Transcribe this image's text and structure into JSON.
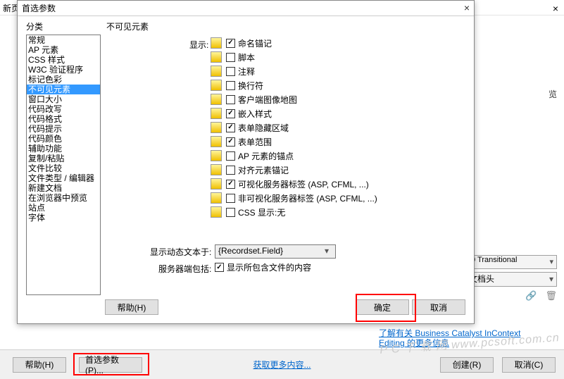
{
  "bg_window": {
    "title": "新页",
    "close_icon": "×",
    "right_label": "览",
    "select1": ".0 Transitional",
    "select2": "文档头",
    "icon_link": "🔗",
    "icon_trash": "🗑",
    "ing": "ing",
    "link_line1": "了解有关 Business Catalyst InContext",
    "link_line2": "Editing 的更多信息"
  },
  "bottom": {
    "help": "帮助(H)",
    "pref": "首选参数(P)...",
    "more_link": "获取更多内容...",
    "create": "创建(R)",
    "cancel": "取消(C)"
  },
  "dialog": {
    "title": "首选参数",
    "close_icon": "×",
    "cat_label": "分类",
    "page_title": "不可见元素",
    "categories": [
      "常规",
      "AP 元素",
      "CSS 样式",
      "W3C 验证程序",
      "标记色彩",
      "不可见元素",
      "窗口大小",
      "代码改写",
      "代码格式",
      "代码提示",
      "代码颜色",
      "辅助功能",
      "复制/粘贴",
      "文件比较",
      "文件类型 / 编辑器",
      "新建文档",
      "在浏览器中预览",
      "站点",
      "字体"
    ],
    "selected_index": 5,
    "show_label": "显示:",
    "options": [
      {
        "label": "命名锚记",
        "checked": true
      },
      {
        "label": "脚本",
        "checked": false
      },
      {
        "label": "注释",
        "checked": false
      },
      {
        "label": "换行符",
        "checked": false
      },
      {
        "label": "客户端图像地图",
        "checked": false
      },
      {
        "label": "嵌入样式",
        "checked": true
      },
      {
        "label": "表单隐藏区域",
        "checked": true
      },
      {
        "label": "表单范围",
        "checked": true
      },
      {
        "label": "AP 元素的锚点",
        "checked": false
      },
      {
        "label": "对齐元素锚记",
        "checked": false
      },
      {
        "label": "可视化服务器标签 (ASP, CFML, ...)",
        "checked": true
      },
      {
        "label": "非可视化服务器标签 (ASP, CFML, ...)",
        "checked": false
      },
      {
        "label": "CSS 显示:无",
        "checked": false
      }
    ],
    "dyn_label": "显示动态文本于:",
    "dyn_value": "{Recordset.Field}",
    "server_label": "服务器端包括:",
    "server_check_label": "显示所包含文件的内容",
    "server_checked": true,
    "help": "帮助(H)",
    "ok": "确定",
    "cancel": "取消"
  },
  "watermark": "P C 下 载 网  www.pcsoft.com.cn"
}
